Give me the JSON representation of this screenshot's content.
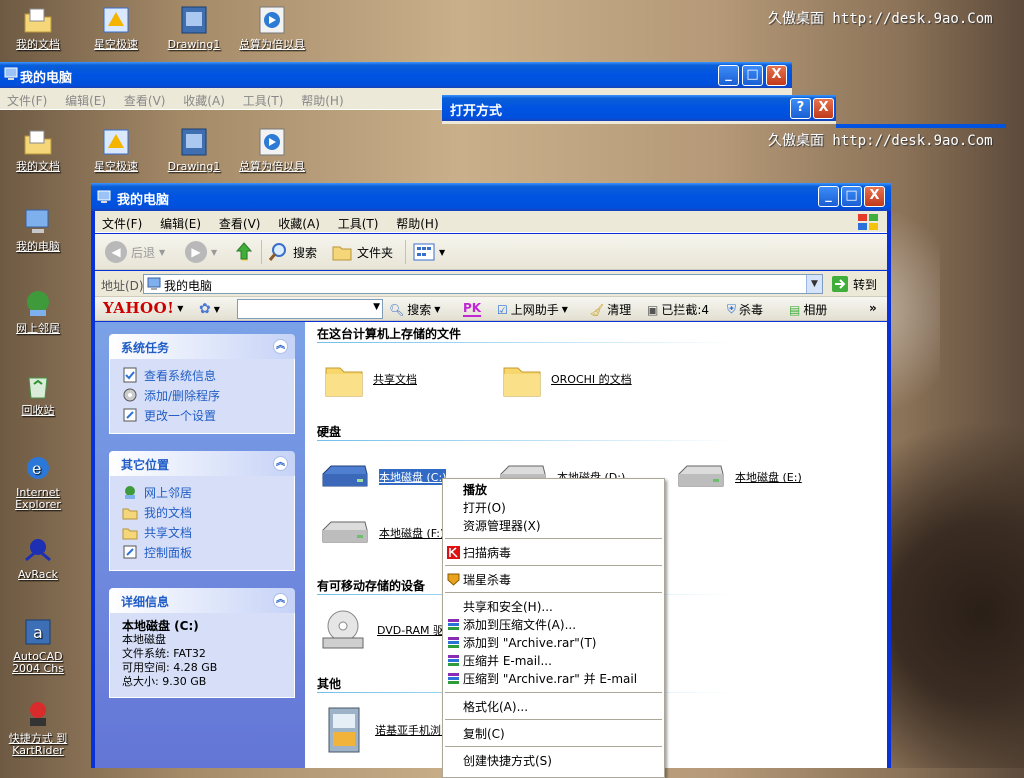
{
  "wallpaper": {
    "link": "久傲桌面 http://desk.9ao.Com"
  },
  "desktop_icons": [
    {
      "label": "我的文档",
      "icon": "my-documents-icon"
    },
    {
      "label": "星空极速",
      "icon": "broadband-dialer-icon"
    },
    {
      "label": "Drawing1",
      "icon": "drawing-file-icon"
    },
    {
      "label": "总算为倍以具",
      "icon": "media-player-icon"
    },
    {
      "label": "我的电脑",
      "icon": "my-computer-icon"
    },
    {
      "label": "网上邻居",
      "icon": "network-places-icon"
    },
    {
      "label": "回收站",
      "icon": "recycle-bin-icon"
    },
    {
      "label": "Internet Explorer",
      "icon": "internet-explorer-icon"
    },
    {
      "label": "AvRack",
      "icon": "avrack-icon"
    },
    {
      "label": "AutoCAD 2004 Chs",
      "icon": "autocad-icon"
    },
    {
      "label": "快捷方式 到 KartRider",
      "icon": "kartrider-icon"
    }
  ],
  "ghost_window": {
    "title": "我的电脑",
    "menus": [
      "文件(F)",
      "编辑(E)",
      "查看(V)",
      "收藏(A)",
      "工具(T)",
      "帮助(H)"
    ],
    "dialog_title": "打开方式",
    "help_btn": "?",
    "close_btn": "X"
  },
  "window": {
    "title": "我的电脑",
    "buttons": {
      "minimize": "_",
      "maximize": "□",
      "close": "X"
    },
    "menus": [
      "文件(F)",
      "编辑(E)",
      "查看(V)",
      "收藏(A)",
      "工具(T)",
      "帮助(H)"
    ],
    "toolbar": {
      "back": "后退",
      "search": "搜索",
      "folders": "文件夹"
    },
    "address": {
      "label": "地址(D)",
      "value": "我的电脑",
      "go": "转到"
    },
    "yahoo": {
      "logo": "YAHOO!",
      "search": "搜索",
      "pk": "PK",
      "assistant": "上网助手",
      "clean": "清理",
      "blocked": "已拦截:4",
      "antivirus": "杀毒",
      "album": "相册",
      "more": "»"
    }
  },
  "left_pane": {
    "system_tasks": {
      "title": "系统任务",
      "items": [
        "查看系统信息",
        "添加/删除程序",
        "更改一个设置"
      ]
    },
    "other_places": {
      "title": "其它位置",
      "items": [
        "网上邻居",
        "我的文档",
        "共享文档",
        "控制面板"
      ]
    },
    "details": {
      "title": "详细信息",
      "name": "本地磁盘 (C:)",
      "type": "本地磁盘",
      "fs": "文件系统: FAT32",
      "free": "可用空间: 4.28 GB",
      "total": "总大小: 9.30 GB"
    }
  },
  "content": {
    "stored_files": {
      "title": "在这台计算机上存储的文件",
      "items": [
        "共享文档",
        "OROCHI 的文档"
      ]
    },
    "hard_disks": {
      "title": "硬盘",
      "items": [
        "本地磁盘 (C:)",
        "本地磁盘 (D:)",
        "本地磁盘 (E:)",
        "本地磁盘 (F:)"
      ]
    },
    "removable": {
      "title": "有可移动存储的设备",
      "items": [
        "DVD-RAM 驱动器"
      ]
    },
    "other": {
      "title": "其他",
      "items": [
        "诺基亚手机浏览器"
      ]
    }
  },
  "context_menu": {
    "items": [
      "播放",
      "打开(O)",
      "资源管理器(X)",
      "扫描病毒",
      "瑞星杀毒",
      "共享和安全(H)...",
      "添加到压缩文件(A)...",
      "添加到 \"Archive.rar\"(T)",
      "压缩并 E-mail...",
      "压缩到 \"Archive.rar\" 并 E-mail",
      "格式化(A)...",
      "复制(C)",
      "创建快捷方式(S)"
    ]
  },
  "colors": {
    "xp_blue": "#0053e1",
    "link_blue": "#215dc6",
    "selection": "#316ac5"
  }
}
